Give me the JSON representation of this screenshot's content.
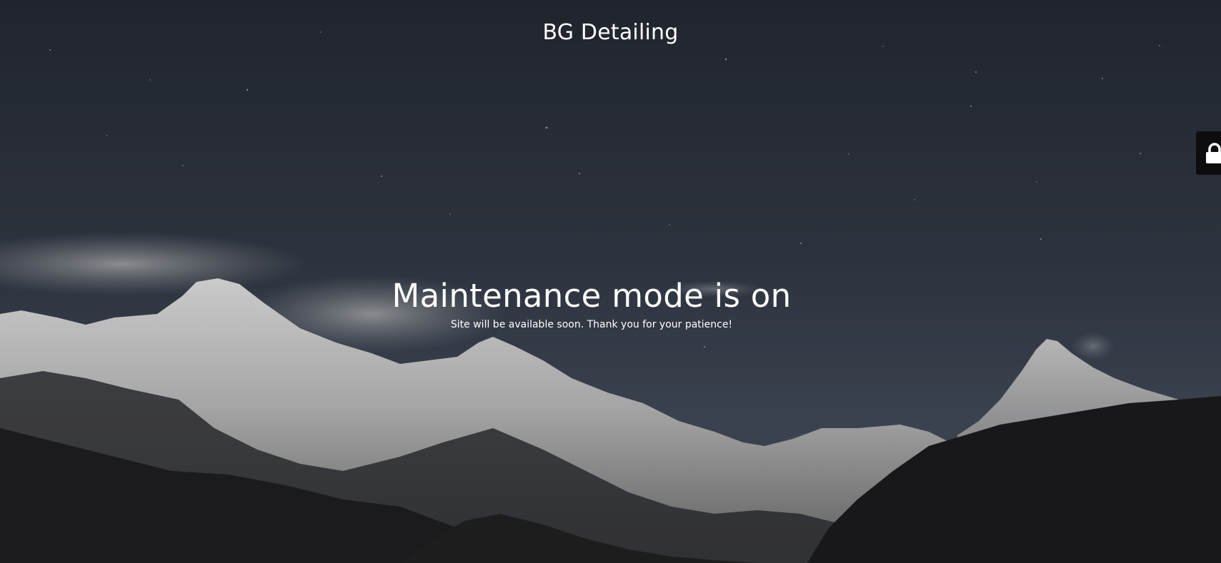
{
  "site": {
    "title": "BG Detailing"
  },
  "maintenance": {
    "heading": "Maintenance mode is on",
    "message": "Site will be available soon. Thank you for your patience!"
  },
  "login_tab": {
    "icon": "lock-icon"
  },
  "colors": {
    "sky_top": "#252a33",
    "sky_bottom": "#3e4756",
    "snow": "#d9d9d9",
    "foreground_mountain": "#1c1c1e",
    "text": "#ffffff",
    "login_tab_bg": "#0d0d10"
  }
}
